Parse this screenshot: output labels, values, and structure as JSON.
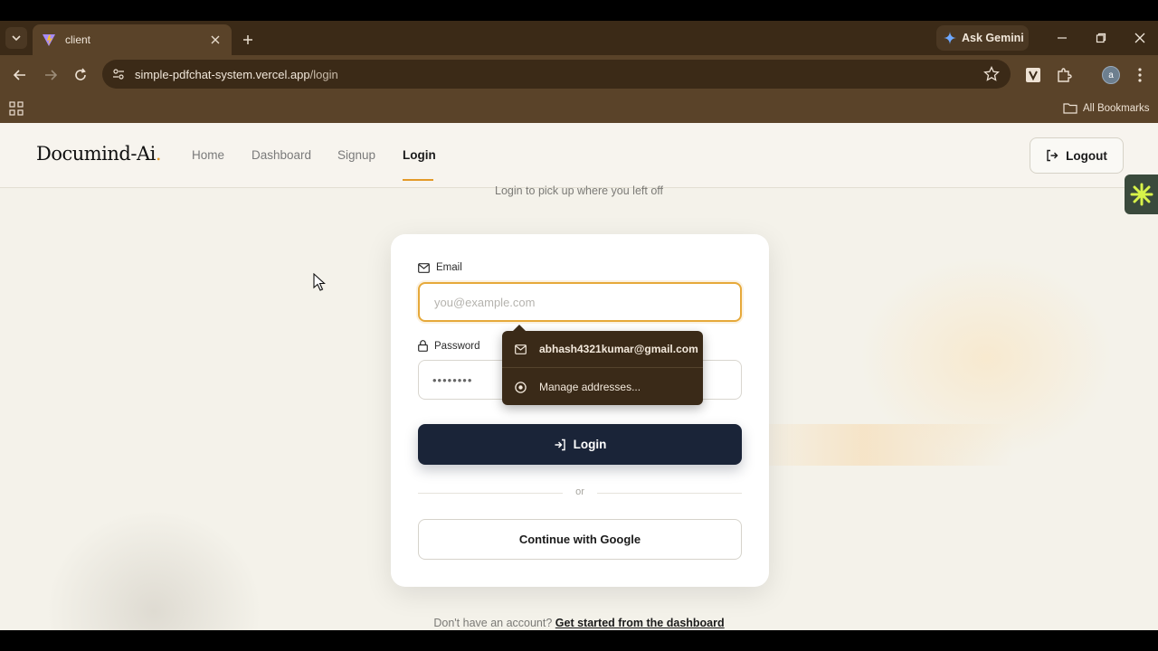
{
  "browser": {
    "tab_title": "client",
    "gemini_label": "Ask Gemini",
    "url_host": "simple-pdfchat-system.vercel.app",
    "url_path": "/login",
    "profile_initial": "a",
    "bookmarks_label": "All Bookmarks"
  },
  "site": {
    "logo_text": "Documind-Ai",
    "logo_dot": ".",
    "nav": [
      {
        "label": "Home"
      },
      {
        "label": "Dashboard"
      },
      {
        "label": "Signup"
      },
      {
        "label": "Login"
      }
    ],
    "logout_label": "Logout"
  },
  "login": {
    "subtitle": "Login to pick up where you left off",
    "email_label": "Email",
    "email_placeholder": "you@example.com",
    "password_label": "Password",
    "password_masked": "••••••••",
    "login_button": "Login",
    "or_text": "or",
    "google_button": "Continue with Google",
    "signup_prompt": "Don't have an account?",
    "signup_link": "Get started from the dashboard"
  },
  "autofill": {
    "suggestion_email": "abhash4321kumar@gmail.com",
    "manage_label": "Manage addresses..."
  },
  "colors": {
    "accent": "#e39a28",
    "primary_button": "#1a2438",
    "chrome_bg": "#5a4329"
  }
}
